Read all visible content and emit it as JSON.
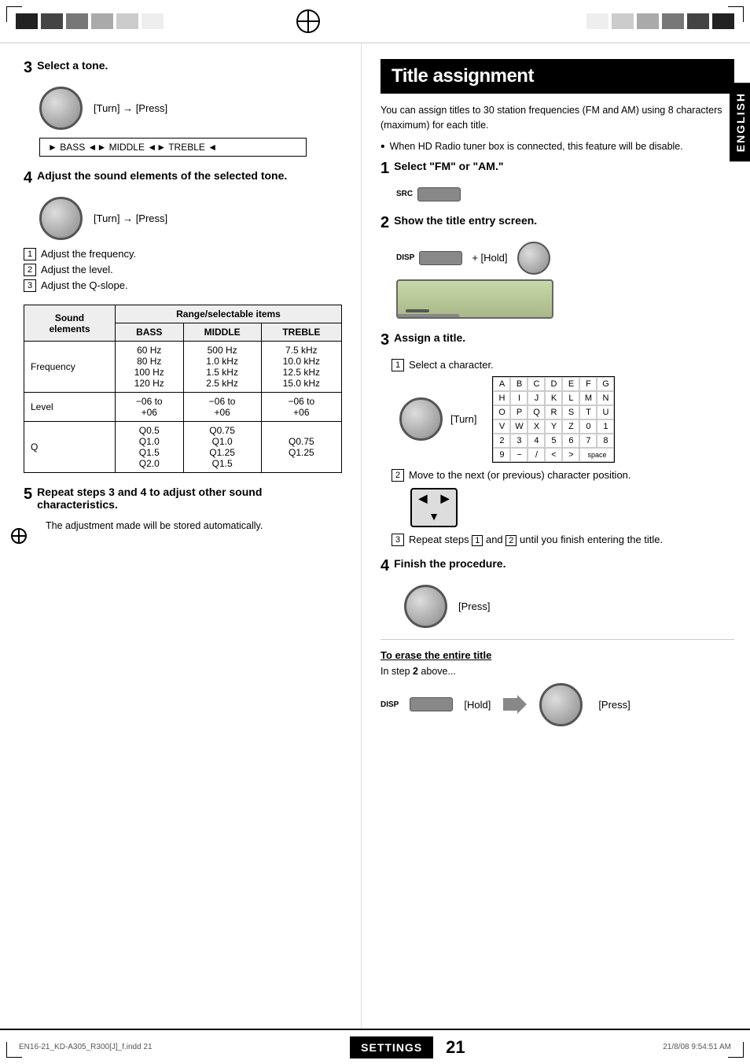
{
  "page": {
    "title": "Title assignment",
    "page_number": "21",
    "settings_label": "SETTINGS",
    "english_tab": "ENGLISH",
    "footer_file": "EN16-21_KD-A305_R300[J]_f.indd   21",
    "footer_date": "21/8/08   9:54:51 AM"
  },
  "left": {
    "step3": {
      "number": "3",
      "title": "Select a tone.",
      "knob_instruction": "[Turn] → [Press]",
      "bmt_bar": "► BASS ◄► MIDDLE ◄► TREBLE ◄"
    },
    "step4": {
      "number": "4",
      "title": "Adjust the sound elements of the selected tone.",
      "knob_instruction": "[Turn] → [Press]",
      "items": [
        {
          "num": "1",
          "text": "Adjust the frequency."
        },
        {
          "num": "2",
          "text": "Adjust the level."
        },
        {
          "num": "3",
          "text": "Adjust the Q-slope."
        }
      ]
    },
    "table": {
      "col_header_1": "Sound elements",
      "col_header_2": "Range/selectable items",
      "col_sub_1": "BASS",
      "col_sub_2": "MIDDLE",
      "col_sub_3": "TREBLE",
      "rows": [
        {
          "label": "Frequency",
          "bass": "60 Hz\n80 Hz\n100 Hz\n120 Hz",
          "middle": "500 Hz\n1.0 kHz\n1.5 kHz\n2.5 kHz",
          "treble": "7.5 kHz\n10.0 kHz\n12.5 kHz\n15.0 kHz"
        },
        {
          "label": "Level",
          "bass": "−06 to\n+06",
          "middle": "−06 to\n+06",
          "treble": "−06 to\n+06"
        },
        {
          "label": "Q",
          "bass": "Q0.5\nQ1.0\nQ1.5\nQ2.0",
          "middle": "Q0.75\nQ1.0\nQ1.25\nQ1.5",
          "treble": "Q0.75\nQ1.25"
        }
      ]
    },
    "step5": {
      "number": "5",
      "title": "Repeat steps 3 and 4 to adjust other sound characteristics.",
      "desc": "The adjustment made will be stored automatically."
    }
  },
  "right": {
    "intro": "You can assign titles to 30 station frequencies (FM and AM) using 8 characters (maximum) for each title.",
    "bullet": "When HD Radio tuner box is connected, this feature will be disable.",
    "step1": {
      "number": "1",
      "title": "Select \"FM\" or \"AM.\"",
      "src_label": "SRC"
    },
    "step2": {
      "number": "2",
      "title": "Show the title entry screen.",
      "disp_label": "DISP",
      "plus_hold": "+ [Hold]"
    },
    "step3": {
      "number": "3",
      "title": "Assign a title.",
      "sub1_num": "1",
      "sub1_text": "Select a character.",
      "turn_label": "[Turn]",
      "char_grid": [
        [
          "A",
          "B",
          "C",
          "D",
          "E",
          "F",
          "G"
        ],
        [
          "H",
          "I",
          "J",
          "K",
          "L",
          "M",
          "N"
        ],
        [
          "O",
          "P",
          "Q",
          "R",
          "S",
          "T",
          "U"
        ],
        [
          "V",
          "W",
          "X",
          "Y",
          "Z",
          "0",
          "1"
        ],
        [
          "2",
          "3",
          "4",
          "5",
          "6",
          "7",
          "8"
        ],
        [
          "9",
          "−",
          "/",
          "<",
          ">",
          "space"
        ]
      ],
      "sub2_num": "2",
      "sub2_text": "Move to the next (or previous) character position.",
      "sub3_num": "3",
      "sub3_text": "Repeat steps",
      "sub3_and": "and",
      "sub3_rest": "until you finish entering the title."
    },
    "step4": {
      "number": "4",
      "title": "Finish the procedure.",
      "press_label": "[Press]"
    },
    "erase": {
      "title": "To erase the entire title",
      "intro": "In step",
      "bold": "2",
      "rest": "above...",
      "disp_label": "DISP",
      "hold_label": "[Hold]",
      "press_label": "[Press]"
    }
  }
}
